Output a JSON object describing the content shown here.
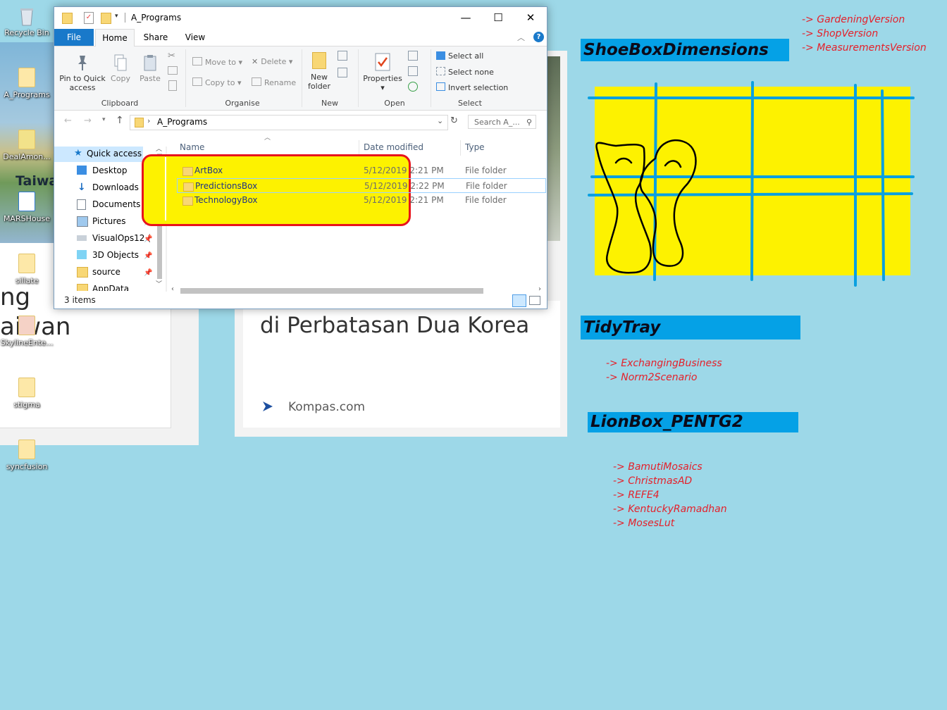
{
  "desktop_icons": [
    {
      "label": "Recycle Bin",
      "icon": "recycle-bin-icon"
    },
    {
      "label": "A_Programs",
      "icon": "folder-icon"
    },
    {
      "label": "DealAmon...",
      "icon": "file-icon"
    },
    {
      "label": "MARSHouse",
      "icon": "edge-file-icon"
    },
    {
      "label": "sillate",
      "icon": "folder-icon"
    },
    {
      "label": "SkylineEnte...",
      "icon": "folder-icon"
    },
    {
      "label": "stigma",
      "icon": "folder-icon"
    },
    {
      "label": "syncfusion",
      "icon": "folder-icon"
    }
  ],
  "background": {
    "map_label": "Taiwa",
    "fragment_ng": "ng",
    "fragment_aiwan": "aiwan",
    "headline_fragment": "di Perbatasan Dua Korea",
    "source": "Kompas.com"
  },
  "explorer": {
    "title": "A_Programs",
    "tabs": {
      "file": "File",
      "home": "Home",
      "share": "Share",
      "view": "View"
    },
    "ribbon": {
      "pin": "Pin to Quick access",
      "copy": "Copy",
      "paste": "Paste",
      "move_to": "Move to",
      "copy_to": "Copy to",
      "delete": "Delete",
      "rename": "Rename",
      "new_folder": "New folder",
      "properties": "Properties",
      "select_all": "Select all",
      "select_none": "Select none",
      "invert_selection": "Invert selection",
      "groups": {
        "clipboard": "Clipboard",
        "organise": "Organise",
        "new": "New",
        "open": "Open",
        "select": "Select"
      }
    },
    "address": {
      "path": "A_Programs",
      "search_placeholder": "Search A_..."
    },
    "nav": [
      {
        "label": "Quick access",
        "icon": "star-icon"
      },
      {
        "label": "Desktop",
        "icon": "desktop-icon"
      },
      {
        "label": "Downloads",
        "icon": "download-icon"
      },
      {
        "label": "Documents",
        "icon": "documents-icon"
      },
      {
        "label": "Pictures",
        "icon": "pictures-icon"
      },
      {
        "label": "VisualOps12 (",
        "icon": "drive-icon"
      },
      {
        "label": "3D Objects",
        "icon": "cube-icon"
      },
      {
        "label": "source",
        "icon": "folder-icon"
      },
      {
        "label": "AppData",
        "icon": "folder-icon"
      }
    ],
    "columns": {
      "name": "Name",
      "date": "Date modified",
      "type": "Type"
    },
    "files": [
      {
        "name": "ArtBox",
        "date": "5/12/2019 2:21 PM",
        "type": "File folder"
      },
      {
        "name": "PredictionsBox",
        "date": "5/12/2019 2:22 PM",
        "type": "File folder"
      },
      {
        "name": "TechnologyBox",
        "date": "5/12/2019 2:21 PM",
        "type": "File folder"
      }
    ],
    "status": "3 items"
  },
  "canvas": {
    "top_links": [
      "-> GardeningVersion",
      "-> ShopVersion",
      "-> MeasurementsVersion"
    ],
    "shoebox_title": "ShoeBoxDimensions",
    "tidytray_title": "TidyTray",
    "tidytray_links": [
      "-> ExchangingBusiness",
      "-> Norm2Scenario"
    ],
    "lionbox_title": "LionBox_PENTG2",
    "lionbox_links": [
      "-> BamutiMosaics",
      "-> ChristmasAD",
      "-> REFE4",
      "-> KentuckyRamadhan",
      "-> MosesLut"
    ],
    "colors": {
      "banner": "#05a1e6",
      "link": "#e5202a",
      "sketch_fill": "#fdf200",
      "grid_line": "#0aa0e0",
      "highlight_border": "#e8141c",
      "highlight_fill": "#fdf200"
    }
  }
}
